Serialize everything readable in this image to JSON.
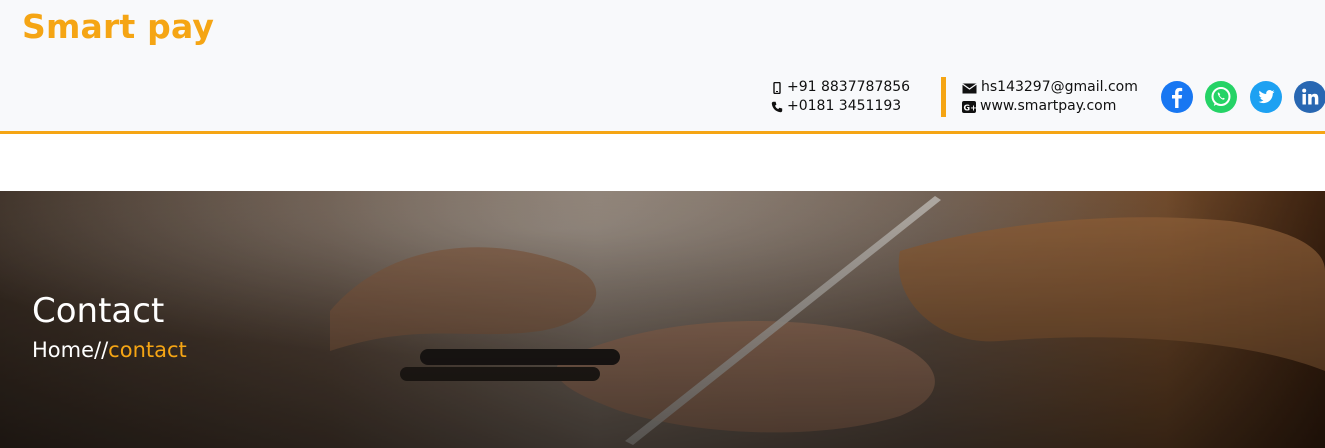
{
  "brand": {
    "name": "Smart pay",
    "accent": "#f5a514"
  },
  "contact": {
    "phone_mobile": "+91 8837787856",
    "phone_landline": "+0181 3451193",
    "email": "hs143297@gmail.com",
    "website": "www.smartpay.com"
  },
  "social": [
    {
      "icon": "facebook-icon",
      "color": "#1877f2"
    },
    {
      "icon": "whatsapp-icon",
      "color": "#25d366"
    },
    {
      "icon": "twitter-icon",
      "color": "#1da1f2"
    },
    {
      "icon": "linkedin-icon",
      "color": "#2867b2"
    }
  ],
  "hero": {
    "title": "Contact",
    "breadcrumb_home": "Home",
    "breadcrumb_sep": "//",
    "breadcrumb_current": "contact"
  }
}
